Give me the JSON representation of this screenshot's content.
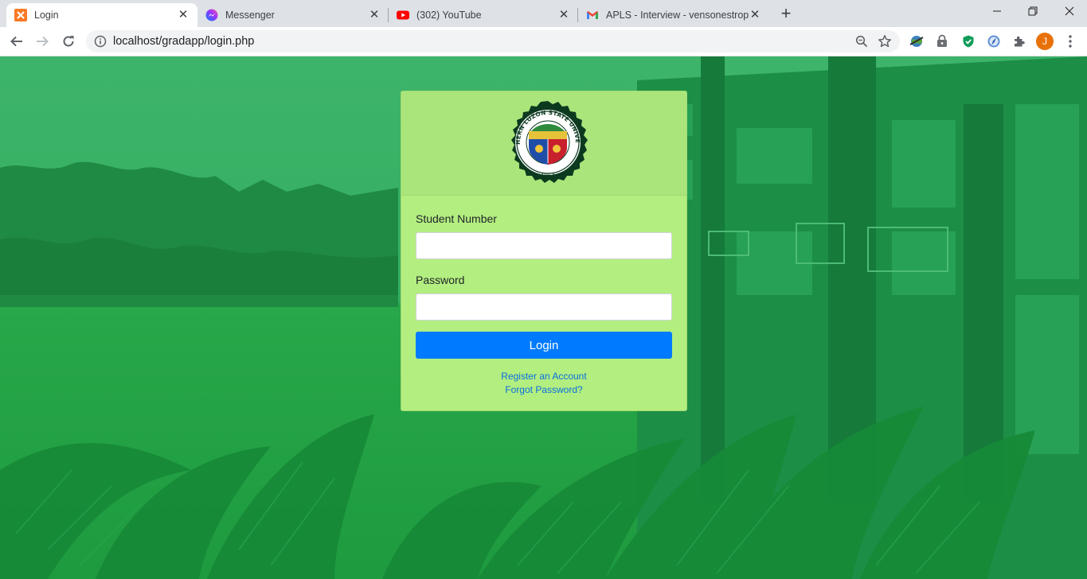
{
  "browser": {
    "tabs": [
      {
        "title": "Login",
        "icon": "xampp-icon",
        "active": true
      },
      {
        "title": "Messenger",
        "icon": "messenger-icon",
        "active": false
      },
      {
        "title": "(302) YouTube",
        "icon": "youtube-icon",
        "active": false
      },
      {
        "title": "APLS - Interview - vensonestropes",
        "icon": "gmail-icon",
        "active": false
      }
    ],
    "url": "localhost/gradapp/login.php",
    "profile_initial": "J"
  },
  "login": {
    "logo_text": {
      "top": "SOUTHERN LUZON STATE UNIVERSITY",
      "year": "1964"
    },
    "student_number_label": "Student Number",
    "student_number_value": "",
    "password_label": "Password",
    "password_value": "",
    "login_button": "Login",
    "register_link": "Register an Account",
    "forgot_link": "Forgot Password?"
  },
  "colors": {
    "card": "#b3ee80",
    "button": "#007bff",
    "background": "#23a04a"
  }
}
